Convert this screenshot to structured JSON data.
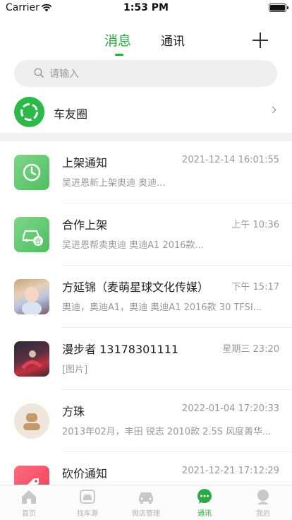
{
  "status_bar": {
    "carrier": "Carrier",
    "time": "1:53 PM"
  },
  "header": {
    "tabs": [
      {
        "label": "消息",
        "active": true
      },
      {
        "label": "通讯",
        "active": false
      }
    ]
  },
  "search": {
    "placeholder": "请输入"
  },
  "moments": {
    "label": "车友圈"
  },
  "messages": [
    {
      "title": "上架通知",
      "time": "2021-12-14 16:01:55",
      "preview": "吴进恩新上架奥迪 奥迪..."
    },
    {
      "title": "合作上架",
      "time": "上午  10:36",
      "preview": "吴进恩帮卖奥迪 奥迪A1 2016款..."
    },
    {
      "title": "方延锦（麦萌星球文化传媒）",
      "time": "下午  15:17",
      "preview": "奥迪，奥迪A1，奥迪 奥迪A1 2016款 30 TFSI..."
    },
    {
      "title": "漫步者 13178301111",
      "time": "星期三  23:20",
      "preview": "[图片]"
    },
    {
      "title": "方珠",
      "time": "2022-01-04 17:20:33",
      "preview": "2013年02月，丰田 锐志 2010款 2.5S 风度菁华..."
    },
    {
      "title": "砍价通知",
      "time": "2021-12-21 17:12:29",
      "preview": ""
    }
  ],
  "tabbar": {
    "items": [
      {
        "label": "首页",
        "icon": "home-icon",
        "active": false
      },
      {
        "label": "找车源",
        "icon": "car-search-icon",
        "active": false
      },
      {
        "label": "微店管理",
        "icon": "car-icon",
        "active": false
      },
      {
        "label": "通讯",
        "icon": "chat-icon",
        "active": true
      },
      {
        "label": "我的",
        "icon": "profile-icon",
        "active": false
      }
    ]
  },
  "colors": {
    "accent": "#2ca845",
    "muted": "#999999",
    "band": "#f2f2f5"
  }
}
